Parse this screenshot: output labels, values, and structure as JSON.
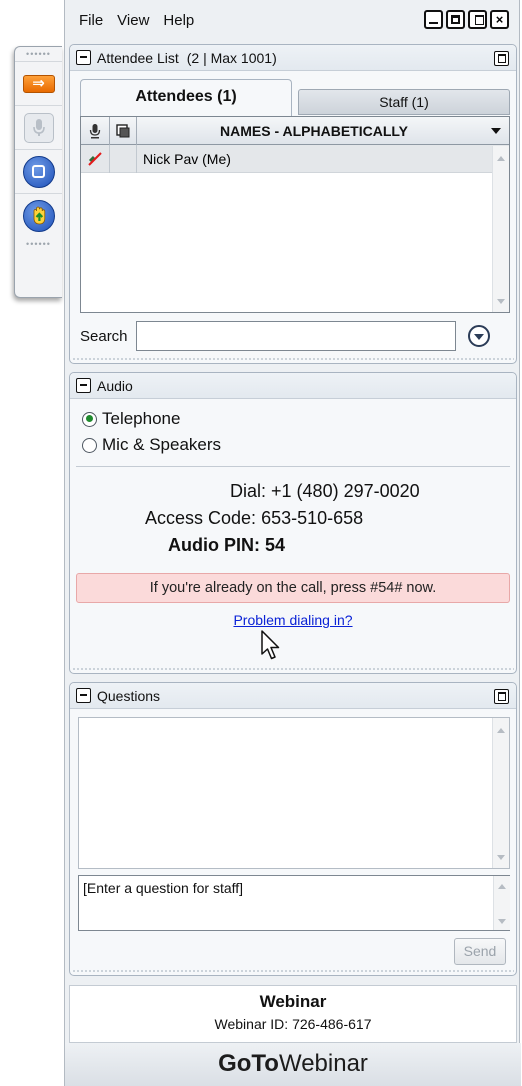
{
  "menu": {
    "file": "File",
    "view": "View",
    "help": "Help"
  },
  "attendee_panel": {
    "title": "Attendee List",
    "count": "(2 | Max 1001)",
    "tabs": {
      "attendees": "Attendees (1)",
      "staff": "Staff (1)"
    },
    "column_header": "NAMES - ALPHABETICALLY",
    "rows": [
      {
        "name": "Nick Pav (Me)"
      }
    ],
    "search_label": "Search",
    "search_value": ""
  },
  "audio_panel": {
    "title": "Audio",
    "options": [
      {
        "label": "Telephone",
        "selected": true
      },
      {
        "label": "Mic & Speakers",
        "selected": false
      }
    ],
    "dial_label": "Dial:",
    "dial_value": "+1 (480) 297-0020",
    "access_label": "Access Code:",
    "access_value": "653-510-658",
    "pin_label": "Audio PIN:",
    "pin_value": "54",
    "alert": "If you're already on the call, press #54# now.",
    "problem_link": "Problem dialing in?"
  },
  "questions_panel": {
    "title": "Questions",
    "input_placeholder": "[Enter a question for staff]",
    "send_label": "Send"
  },
  "footer": {
    "webinar_title": "Webinar",
    "webinar_id_label": "Webinar ID:",
    "webinar_id": "726-486-617",
    "brand_bold": "GoTo",
    "brand_regular": "Webinar"
  },
  "colors": {
    "alert_bg": "#fbdada",
    "link": "#0b22d6",
    "radio_selected": "#1f8a2e",
    "grab_arrow": "#f28a1b",
    "grab_circle": "#1c4fb8"
  },
  "icons": {
    "grab_tab": [
      "show-control-panel-icon",
      "mic-icon",
      "screen-icon",
      "raise-hand-icon"
    ],
    "window": [
      "minimize-icon",
      "maximize-icon",
      "restore-icon",
      "close-icon"
    ]
  }
}
